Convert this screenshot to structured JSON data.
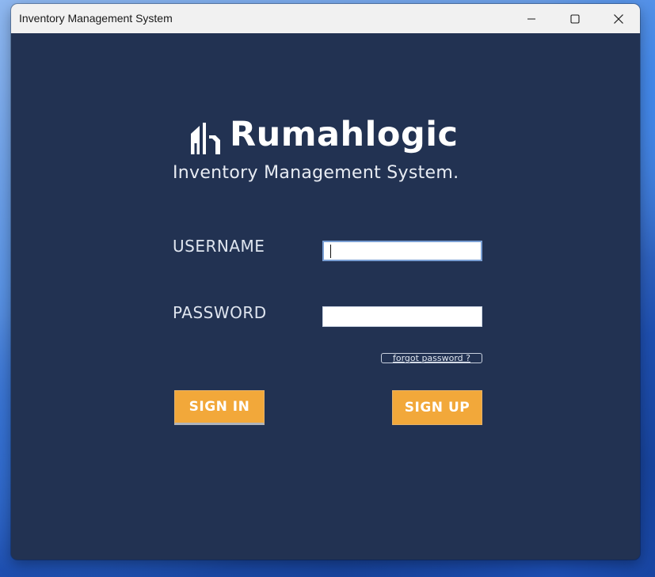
{
  "window": {
    "title": "Inventory Management System",
    "controls": [
      "minimize-icon",
      "maximize-icon",
      "close-icon"
    ]
  },
  "branding": {
    "name": "Rumahlogic",
    "tagline": "Inventory Management System.",
    "logo_icon": "house-outline-icon"
  },
  "form": {
    "username_label": "USERNAME",
    "username_value": "",
    "password_label": "PASSWORD",
    "password_value": "",
    "forgot_password": "forgot password ?",
    "sign_in": "SIGN IN",
    "sign_up": "SIGN UP"
  },
  "colors": {
    "background": "#223252",
    "button": "#f2a83a",
    "titlebar": "#f1f1f1"
  }
}
